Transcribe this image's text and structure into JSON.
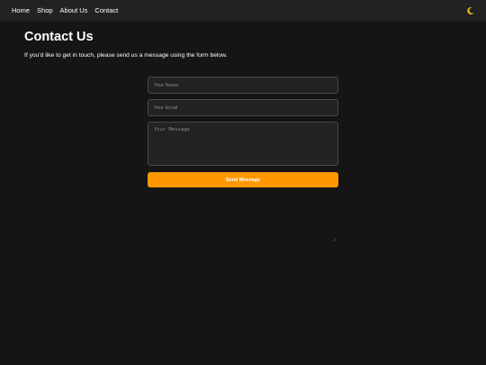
{
  "nav": {
    "links": [
      {
        "label": "Home"
      },
      {
        "label": "Shop"
      },
      {
        "label": "About Us"
      },
      {
        "label": "Contact"
      }
    ],
    "theme_toggle_icon": "crescent-moon-icon"
  },
  "main": {
    "title": "Contact Us",
    "intro": "If you'd like to get in touch, please send us a message using the form below."
  },
  "form": {
    "name_placeholder": "Your Name",
    "name_value": "",
    "email_placeholder": "Your Email",
    "email_value": "",
    "message_placeholder": "Your Message",
    "message_value": "",
    "submit_label": "Send Message"
  },
  "colors": {
    "page_background": "#151515",
    "navbar_background": "#222222",
    "field_background": "#222222",
    "field_border": "#4a4a4a",
    "accent": "#ff9800",
    "moon_icon": "#f5c518"
  }
}
